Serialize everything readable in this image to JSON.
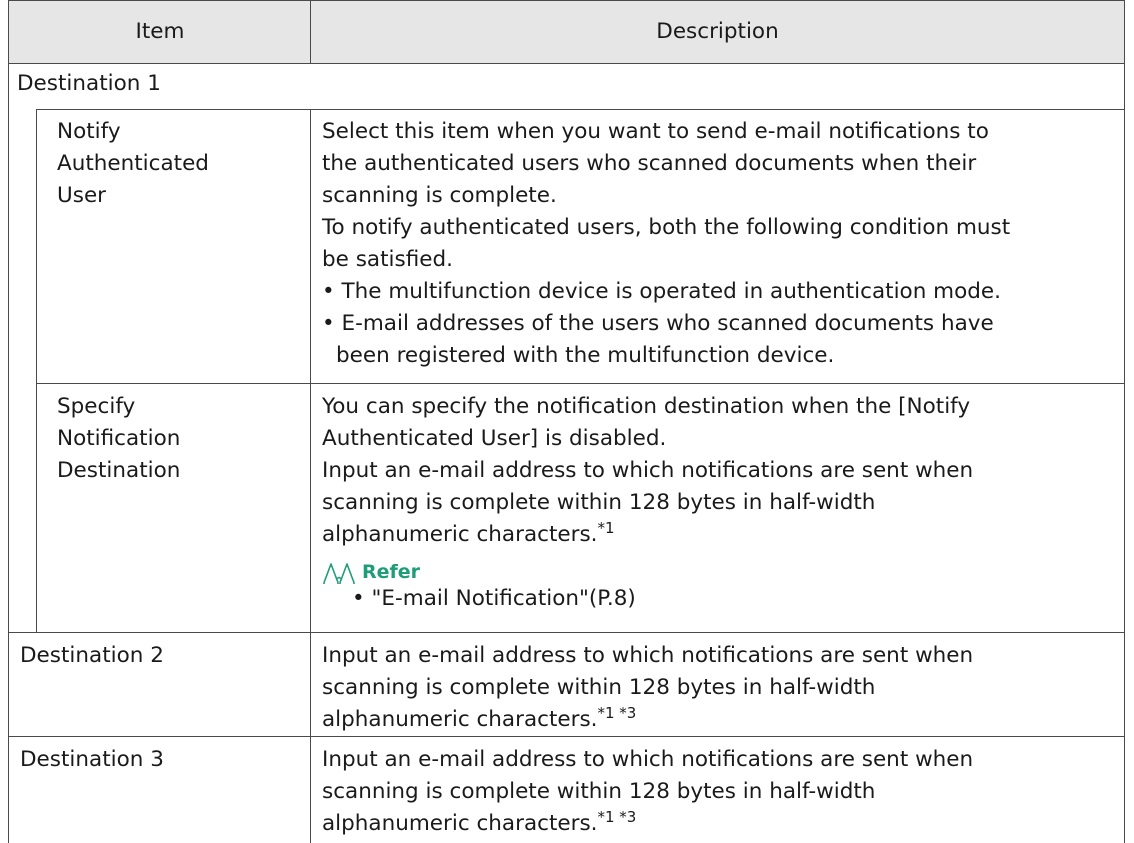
{
  "table": {
    "header": {
      "item": "Item",
      "description": "Description"
    },
    "destination1": {
      "title": "Destination 1",
      "notify": {
        "label_lines": [
          "Notify",
          "Authenticated",
          "User"
        ],
        "desc_lines": [
          "Select this item when you want to send e-mail notifications to",
          "the authenticated users who scanned documents when their",
          "scanning is complete.",
          "To notify authenticated users, both the following condition must",
          "be satisfied."
        ],
        "bullets": [
          "• The multifunction device is operated in authentication mode.",
          "• E-mail addresses of the users who scanned documents have"
        ],
        "bullet_cont": "been registered with the multifunction device."
      },
      "specify": {
        "label_lines": [
          "Specify",
          "Notification",
          "Destination"
        ],
        "desc_lines": [
          "You can specify the notification destination when the [Notify",
          "Authenticated User] is disabled.",
          "Input an e-mail address to which notifications are sent when",
          "scanning is complete within 128 bytes in half-width"
        ],
        "desc_last": "alphanumeric characters.",
        "footnote": "*1",
        "refer_label": "Refer",
        "refer_item": "• \"E-mail Notification\"(P.8)"
      }
    },
    "destination2": {
      "title": "Destination 2",
      "desc_lines": [
        "Input an e-mail address to which notifications are sent when",
        "scanning is complete within 128 bytes in half-width"
      ],
      "desc_last": "alphanumeric characters.",
      "footnote": "*1 *3"
    },
    "destination3": {
      "title": "Destination 3",
      "desc_lines": [
        "Input an e-mail address to which notifications are sent when",
        "scanning is complete within 128 bytes in half-width"
      ],
      "desc_last": "alphanumeric characters.",
      "footnote": "*1 *3"
    }
  }
}
